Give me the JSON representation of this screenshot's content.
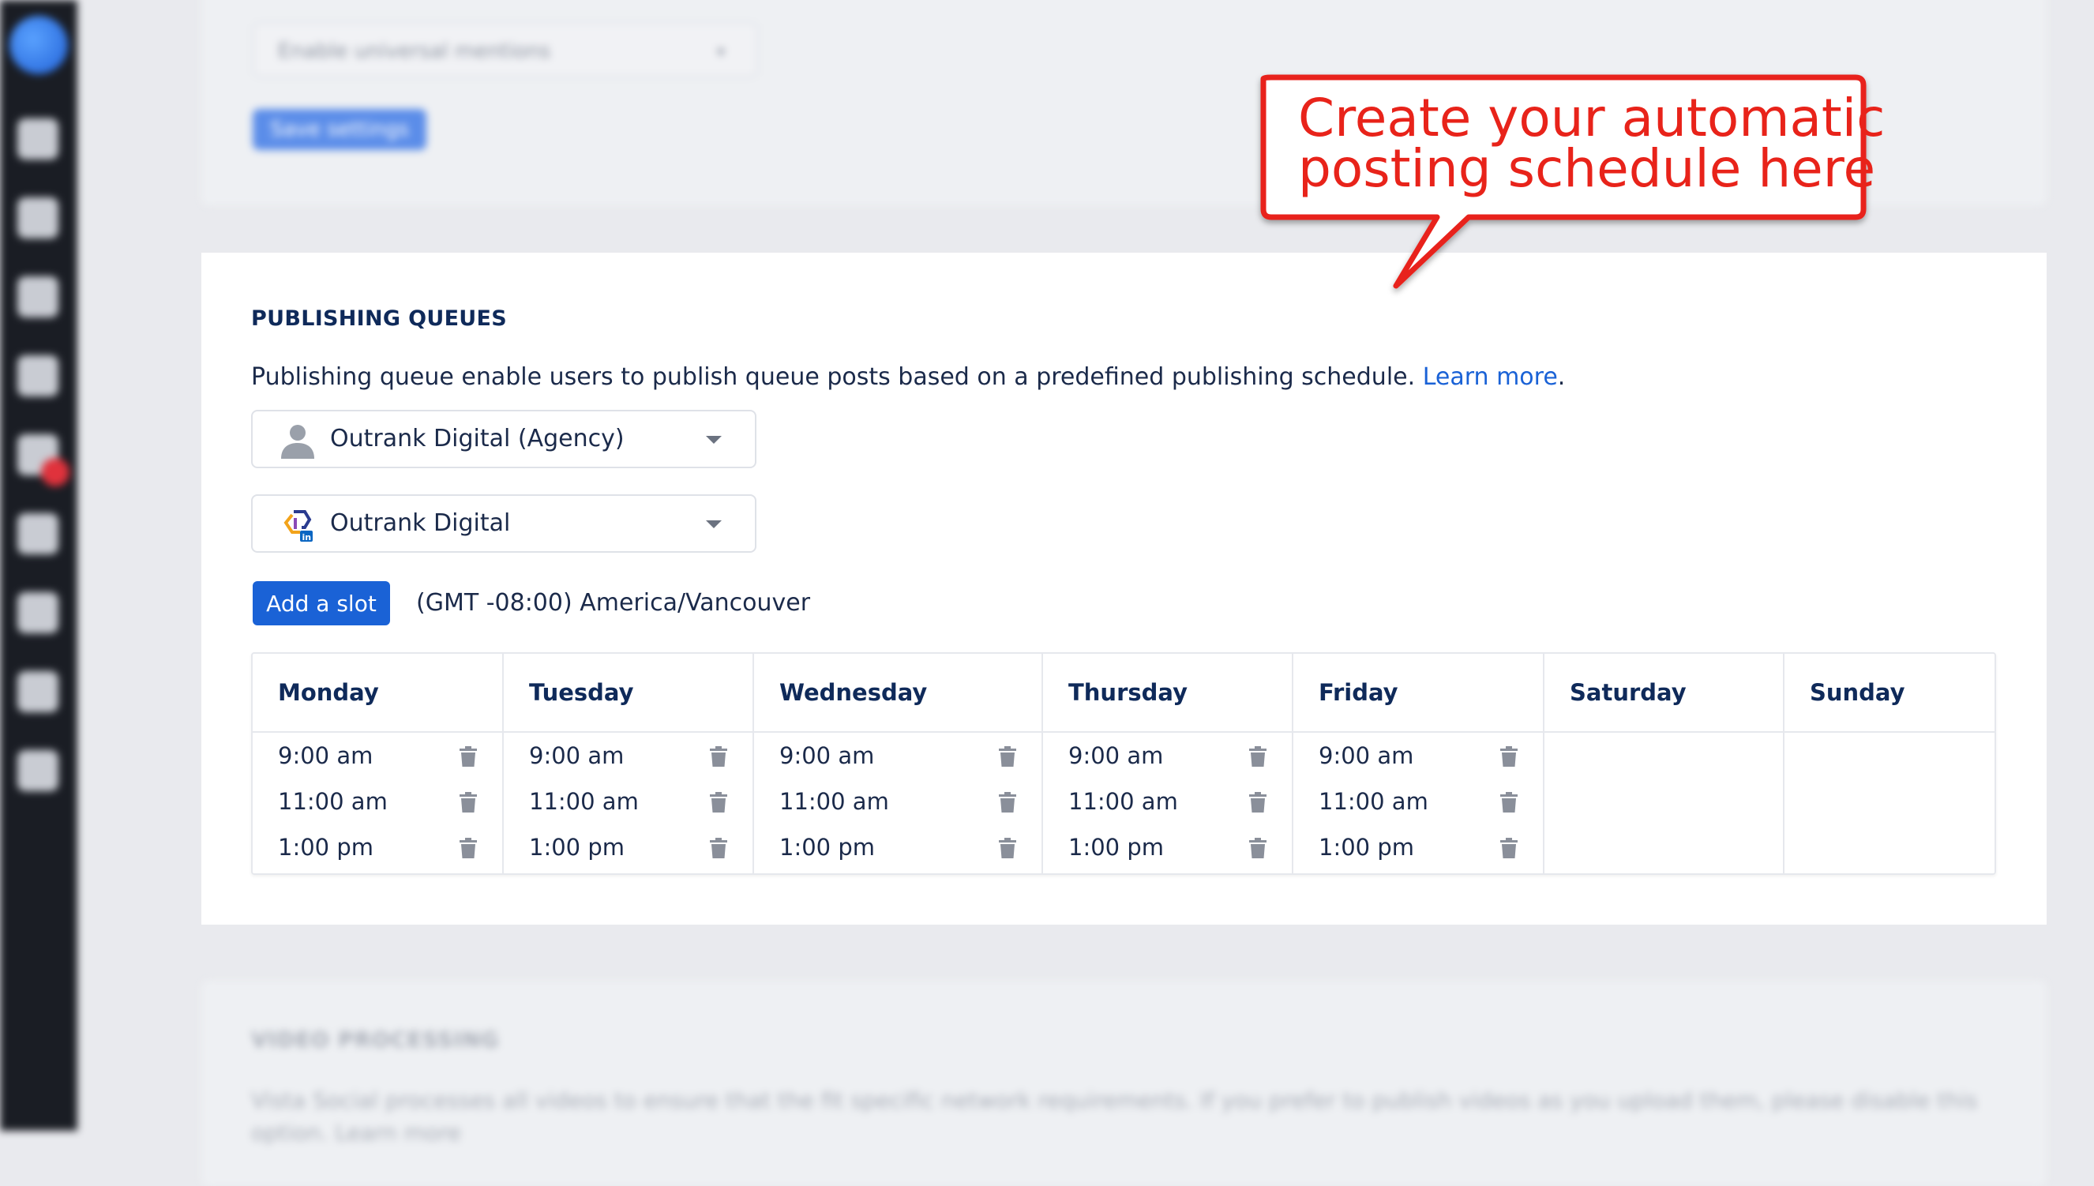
{
  "background": {
    "top_select_placeholder": "Enable universal mentions",
    "top_button_label": "Save settings",
    "bottom_heading": "VIDEO PROCESSING",
    "bottom_text": "Vista Social processes all videos to ensure that the fit specific network requirements. If you prefer to publish videos as you upload them, please disable this",
    "bottom_text_2": "option. Learn more"
  },
  "publishing_queues": {
    "heading": "PUBLISHING QUEUES",
    "description": "Publishing queue enable users to publish queue posts based on a predefined publishing schedule.",
    "learn_more": "Learn more",
    "period": ".",
    "agency_select": "Outrank Digital (Agency)",
    "profile_select": "Outrank Digital",
    "add_slot_label": "Add a slot",
    "timezone": "(GMT -08:00) America/Vancouver",
    "days": [
      {
        "name": "Monday",
        "slots": [
          "9:00 am",
          "11:00 am",
          "1:00 pm"
        ]
      },
      {
        "name": "Tuesday",
        "slots": [
          "9:00 am",
          "11:00 am",
          "1:00 pm"
        ]
      },
      {
        "name": "Wednesday",
        "slots": [
          "9:00 am",
          "11:00 am",
          "1:00 pm"
        ]
      },
      {
        "name": "Thursday",
        "slots": [
          "9:00 am",
          "11:00 am",
          "1:00 pm"
        ]
      },
      {
        "name": "Friday",
        "slots": [
          "9:00 am",
          "11:00 am",
          "1:00 pm"
        ]
      },
      {
        "name": "Saturday",
        "slots": []
      },
      {
        "name": "Sunday",
        "slots": []
      }
    ]
  },
  "callout": {
    "line1": "Create your automatic",
    "line2": "posting schedule here",
    "color": "#e8231a"
  },
  "colors": {
    "accent": "#1a62d6",
    "heading": "#0f2a5a"
  }
}
